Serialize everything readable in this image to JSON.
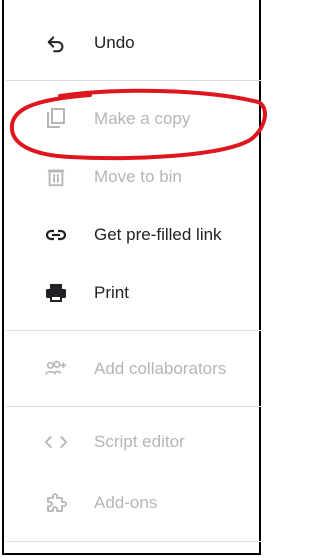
{
  "menu": {
    "undo": "Undo",
    "make_copy": "Make a copy",
    "move_to_bin": "Move to bin",
    "prefilled_link": "Get pre-filled link",
    "print": "Print",
    "add_collaborators": "Add collaborators",
    "script_editor": "Script editor",
    "add_ons": "Add-ons"
  },
  "colors": {
    "enabled_text": "#202124",
    "disabled_text": "#b5b5b5",
    "annotation": "#e0161e"
  },
  "icons": {
    "undo": "undo-icon",
    "make_copy": "copy-icon",
    "move_to_bin": "trash-icon",
    "prefilled_link": "link-icon",
    "print": "print-icon",
    "add_collaborators": "add-people-icon",
    "script_editor": "code-icon",
    "add_ons": "puzzle-icon"
  }
}
